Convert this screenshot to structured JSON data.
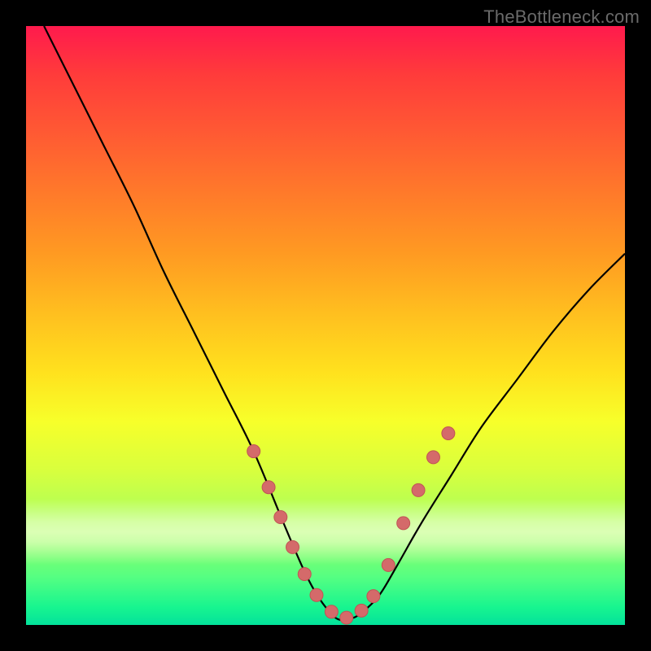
{
  "watermark": "TheBottleneck.com",
  "chart_data": {
    "type": "line",
    "title": "",
    "xlabel": "",
    "ylabel": "",
    "xlim": [
      0,
      100
    ],
    "ylim": [
      0,
      100
    ],
    "grid": false,
    "legend": false,
    "series": [
      {
        "name": "curve",
        "x": [
          3,
          8,
          13,
          18,
          23,
          28,
          33,
          38,
          43,
          46,
          48,
          50,
          52,
          54,
          56,
          59,
          62,
          66,
          71,
          76,
          82,
          88,
          94,
          100
        ],
        "y": [
          100,
          90,
          80,
          70,
          59,
          49,
          39,
          29,
          17,
          10,
          6,
          3,
          1,
          1,
          2,
          5,
          10,
          17,
          25,
          33,
          41,
          49,
          56,
          62
        ]
      }
    ],
    "markers": [
      {
        "name": "marker",
        "x": 38,
        "y": 29
      },
      {
        "name": "marker",
        "x": 40.5,
        "y": 23
      },
      {
        "name": "marker",
        "x": 42.5,
        "y": 18
      },
      {
        "name": "marker",
        "x": 44.5,
        "y": 13
      },
      {
        "name": "marker",
        "x": 46.5,
        "y": 8.5
      },
      {
        "name": "marker",
        "x": 48.5,
        "y": 5
      },
      {
        "name": "marker",
        "x": 51,
        "y": 2.2
      },
      {
        "name": "marker",
        "x": 53.5,
        "y": 1.2
      },
      {
        "name": "marker",
        "x": 56,
        "y": 2.4
      },
      {
        "name": "marker",
        "x": 58,
        "y": 4.8
      },
      {
        "name": "marker",
        "x": 60.5,
        "y": 10
      },
      {
        "name": "marker",
        "x": 63,
        "y": 17
      },
      {
        "name": "marker",
        "x": 65.5,
        "y": 22.5
      },
      {
        "name": "marker",
        "x": 68,
        "y": 28
      },
      {
        "name": "marker",
        "x": 70.5,
        "y": 32
      }
    ],
    "glow_band": {
      "y_center": 15,
      "height": 12
    },
    "colors": {
      "curve_stroke": "#000000",
      "marker_fill": "#d46a6a",
      "marker_stroke": "#c05454",
      "gradient_top": "#ff1a4d",
      "gradient_bottom": "#03e29b",
      "frame": "#000000",
      "watermark": "#6a6a6a"
    }
  }
}
